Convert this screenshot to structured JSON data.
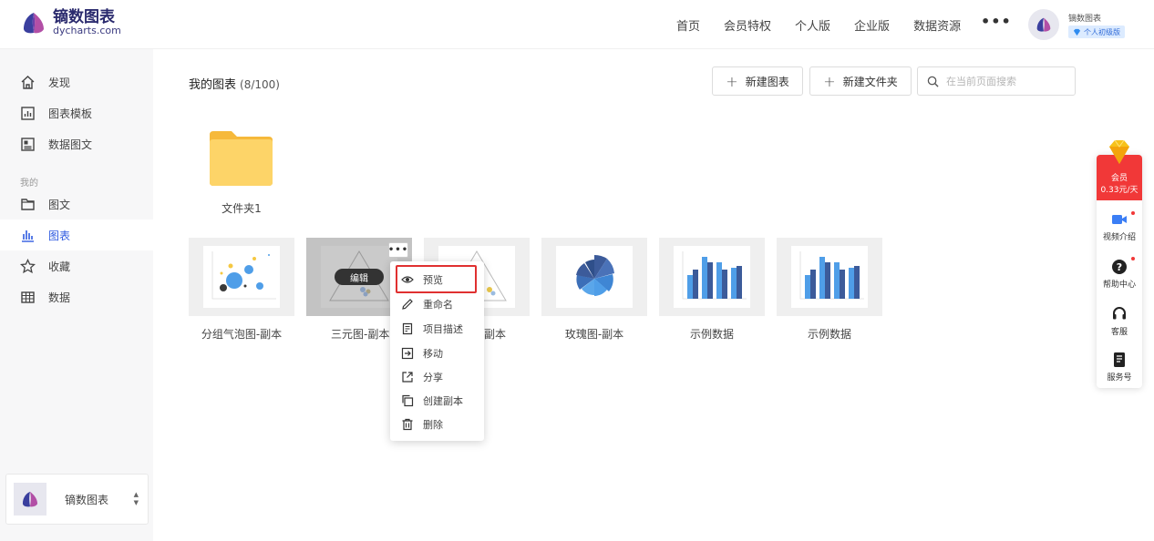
{
  "brand": {
    "name_cn": "镝数图表",
    "name_en": "dycharts.com"
  },
  "nav": [
    "首页",
    "会员特权",
    "个人版",
    "企业版",
    "数据资源"
  ],
  "nav_more": "•••",
  "user": {
    "name": "镝数图表",
    "badge": "个人初级版"
  },
  "sidebar": {
    "top_items": [
      {
        "label": "发现",
        "icon": "home-icon"
      },
      {
        "label": "图表模板",
        "icon": "chart-template-icon"
      },
      {
        "label": "数据图文",
        "icon": "data-article-icon"
      }
    ],
    "group_label": "我的",
    "my_items": [
      {
        "label": "图文",
        "icon": "article-icon"
      },
      {
        "label": "图表",
        "icon": "bar-chart-icon",
        "active": true
      },
      {
        "label": "收藏",
        "icon": "star-icon"
      },
      {
        "label": "数据",
        "icon": "table-icon"
      }
    ],
    "team": {
      "name": "镝数图表"
    }
  },
  "main": {
    "title": "我的图表",
    "count": "(8/100)",
    "new_chart": "新建图表",
    "new_folder": "新建文件夹",
    "search_placeholder": "在当前页面搜索",
    "folder": {
      "name": "文件夹1"
    },
    "charts": [
      {
        "name": "分组气泡图-副本"
      },
      {
        "name": "三元图-副本",
        "hover": true,
        "edit_label": "编辑"
      },
      {
        "name": "副本"
      },
      {
        "name": "玫瑰图-副本"
      },
      {
        "name": "示例数据"
      },
      {
        "name": "示例数据"
      }
    ]
  },
  "context_menu": [
    {
      "label": "预览",
      "icon": "eye-icon"
    },
    {
      "label": "重命名",
      "icon": "pencil-icon"
    },
    {
      "label": "项目描述",
      "icon": "description-icon"
    },
    {
      "label": "移动",
      "icon": "move-icon"
    },
    {
      "label": "分享",
      "icon": "share-icon"
    },
    {
      "label": "创建副本",
      "icon": "copy-icon"
    },
    {
      "label": "删除",
      "icon": "trash-icon"
    }
  ],
  "float_panel": {
    "vip_label": "会员",
    "vip_price": "0.33元/天",
    "items": [
      {
        "label": "视频介绍",
        "icon": "video-icon"
      },
      {
        "label": "帮助中心",
        "icon": "help-icon"
      },
      {
        "label": "客服",
        "icon": "headset-icon"
      },
      {
        "label": "服务号",
        "icon": "service-icon"
      }
    ]
  },
  "colors": {
    "accent": "#2f5be0",
    "vip_red": "#f13838",
    "folder": "#f8c545",
    "chart_blue": "#4f9ee8",
    "chart_navy": "#3c5b9a"
  }
}
